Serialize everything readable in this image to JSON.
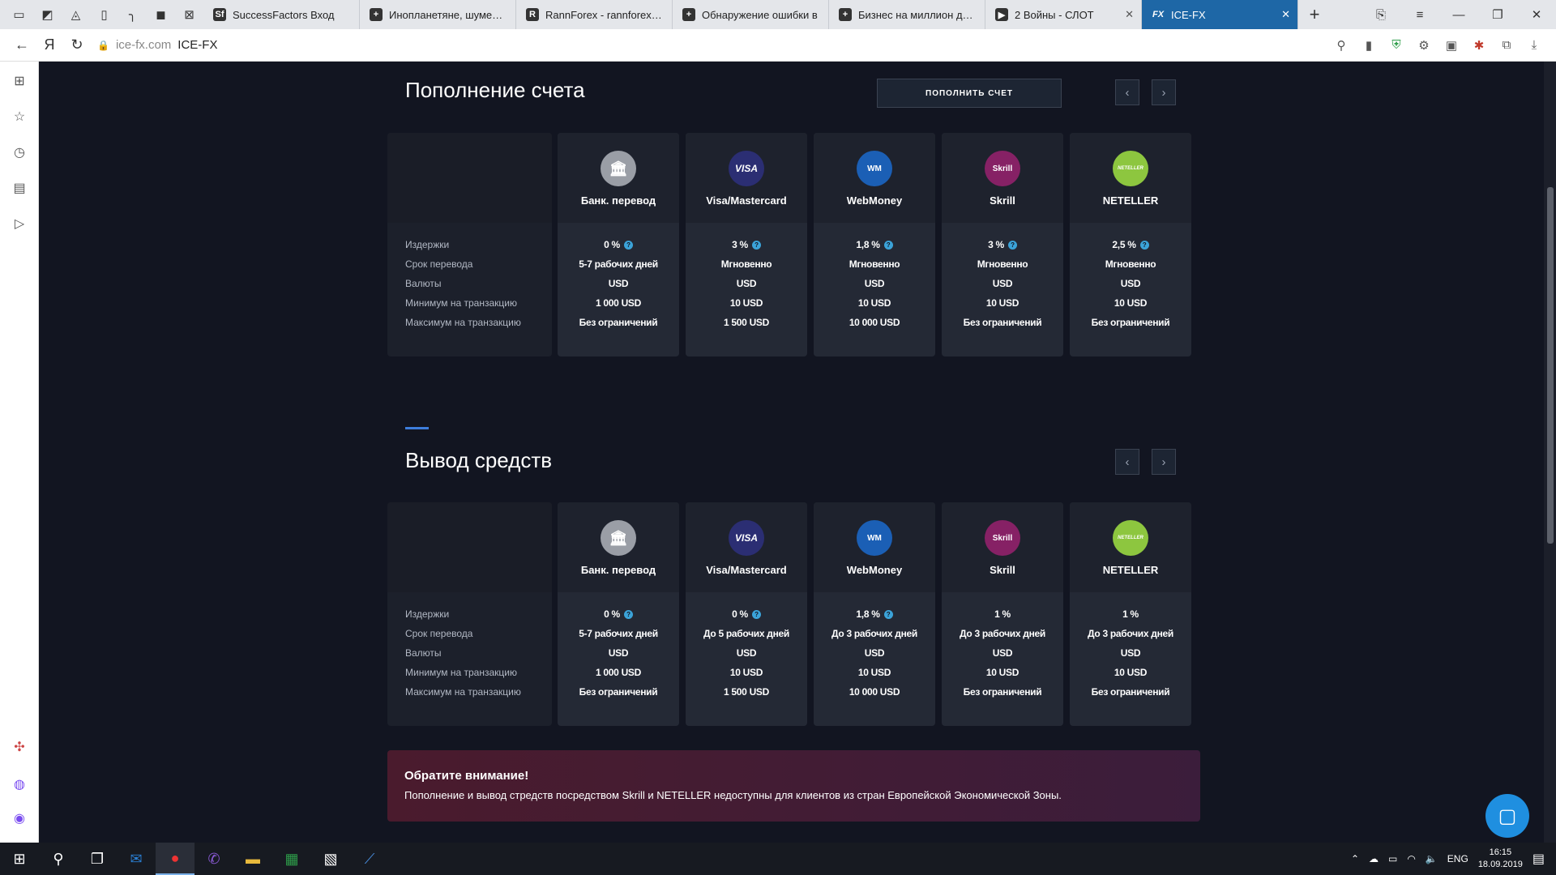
{
  "browser": {
    "tabs": [
      {
        "title": "SuccessFactors Вход",
        "favicon": "sf-favicon",
        "icon_text": "Sf"
      },
      {
        "title": "Инопланетяне, шумеры и",
        "favicon": "plus-favicon",
        "icon_text": "+"
      },
      {
        "title": "RannForex - rannforex.com",
        "favicon": "rannforex-favicon",
        "icon_text": "R"
      },
      {
        "title": "Обнаружение ошибки в",
        "favicon": "plus-favicon",
        "icon_text": "+"
      },
      {
        "title": "Бизнес на миллион долл",
        "favicon": "plus-favicon",
        "icon_text": "+"
      },
      {
        "title": "2 Войны - СЛОТ",
        "favicon": "play-favicon",
        "icon_text": "▶"
      },
      {
        "title": "ICE-FX",
        "favicon": "fx-favicon",
        "icon_text": "FX",
        "active": true
      }
    ],
    "address": {
      "domain": "ice-fx.com",
      "title": "ICE-FX"
    }
  },
  "deposit": {
    "title": "Пополнение счета",
    "button": "ПОПОЛНИТЬ СЧЕТ",
    "row_labels": [
      "Издержки",
      "Срок перевода",
      "Валюты",
      "Минимум на транзакцию",
      "Максимум на транзакцию"
    ],
    "methods": [
      {
        "name": "Банк. перевод",
        "logo": "bank-logo",
        "logo_text": "🏛",
        "color": "#9a9ea6",
        "fee": "0 %",
        "info": true,
        "term": "5-7 рабочих дней",
        "currency": "USD",
        "min": "1 000 USD",
        "max": "Без ограничений"
      },
      {
        "name": "Visa/Mastercard",
        "logo": "visa-logo",
        "logo_text": "VISA",
        "color": "#2b2e73",
        "fee": "3 %",
        "info": true,
        "term": "Мгновенно",
        "currency": "USD",
        "min": "10 USD",
        "max": "1 500 USD"
      },
      {
        "name": "WebMoney",
        "logo": "webmoney-logo",
        "logo_text": "WM",
        "color": "#1b5fb5",
        "fee": "1,8 %",
        "info": true,
        "term": "Мгновенно",
        "currency": "USD",
        "min": "10 USD",
        "max": "10 000 USD"
      },
      {
        "name": "Skrill",
        "logo": "skrill-logo",
        "logo_text": "Skrill",
        "color": "#862165",
        "fee": "3 %",
        "info": true,
        "term": "Мгновенно",
        "currency": "USD",
        "min": "10 USD",
        "max": "Без ограничений"
      },
      {
        "name": "NETELLER",
        "logo": "neteller-logo",
        "logo_text": "NETELLER",
        "color": "#8dc63f",
        "fee": "2,5 %",
        "info": true,
        "term": "Мгновенно",
        "currency": "USD",
        "min": "10 USD",
        "max": "Без ограничений"
      }
    ]
  },
  "withdraw": {
    "title": "Вывод средств",
    "row_labels": [
      "Издержки",
      "Срок перевода",
      "Валюты",
      "Минимум на транзакцию",
      "Максимум на транзакцию"
    ],
    "methods": [
      {
        "name": "Банк. перевод",
        "logo": "bank-logo",
        "logo_text": "🏛",
        "color": "#9a9ea6",
        "fee": "0 %",
        "info": true,
        "term": "5-7 рабочих дней",
        "currency": "USD",
        "min": "1 000 USD",
        "max": "Без ограничений"
      },
      {
        "name": "Visa/Mastercard",
        "logo": "visa-logo",
        "logo_text": "VISA",
        "color": "#2b2e73",
        "fee": "0 %",
        "info": true,
        "term": "До 5 рабочих дней",
        "currency": "USD",
        "min": "10 USD",
        "max": "1 500 USD"
      },
      {
        "name": "WebMoney",
        "logo": "webmoney-logo",
        "logo_text": "WM",
        "color": "#1b5fb5",
        "fee": "1,8 %",
        "info": true,
        "term": "До 3 рабочих дней",
        "currency": "USD",
        "min": "10 USD",
        "max": "10 000 USD"
      },
      {
        "name": "Skrill",
        "logo": "skrill-logo",
        "logo_text": "Skrill",
        "color": "#862165",
        "fee": "1 %",
        "info": false,
        "term": "До 3 рабочих дней",
        "currency": "USD",
        "min": "10 USD",
        "max": "Без ограничений"
      },
      {
        "name": "NETELLER",
        "logo": "neteller-logo",
        "logo_text": "NETELLER",
        "color": "#8dc63f",
        "fee": "1 %",
        "info": false,
        "term": "До 3 рабочих дней",
        "currency": "USD",
        "min": "10 USD",
        "max": "Без ограничений"
      }
    ]
  },
  "notice": {
    "title": "Обратите внимание!",
    "body": "Пополнение и вывод стредств посредством Skrill и NETELLER недоступны для клиентов из стран Европейской Экономической Зоны."
  },
  "taskbar": {
    "language": "ENG",
    "time": "16:15",
    "date": "18.09.2019"
  },
  "colors": {
    "accent": "#3d7ddc",
    "background": "#121521",
    "info_icon": "#3ba3d9"
  }
}
